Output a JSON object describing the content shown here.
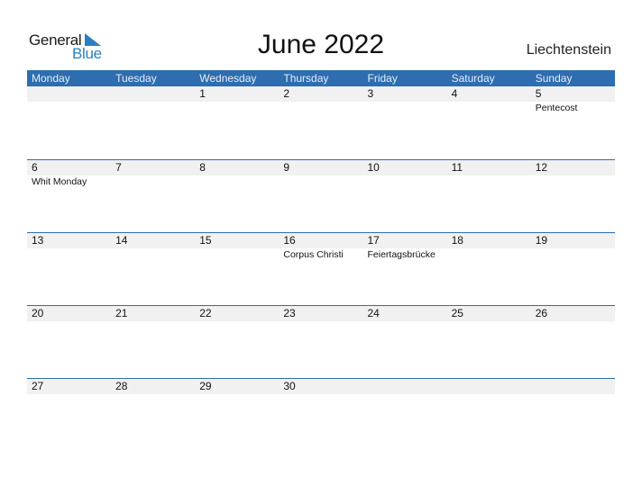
{
  "logo": {
    "general": "General",
    "blue": "Blue"
  },
  "title": "June 2022",
  "country": "Liechtenstein",
  "weekdays": [
    "Monday",
    "Tuesday",
    "Wednesday",
    "Thursday",
    "Friday",
    "Saturday",
    "Sunday"
  ],
  "weeks": [
    {
      "dates": [
        "",
        "",
        "1",
        "2",
        "3",
        "4",
        "5"
      ],
      "holidays": [
        "",
        "",
        "",
        "",
        "",
        "",
        "Pentecost"
      ]
    },
    {
      "dates": [
        "6",
        "7",
        "8",
        "9",
        "10",
        "11",
        "12"
      ],
      "holidays": [
        "Whit Monday",
        "",
        "",
        "",
        "",
        "",
        ""
      ]
    },
    {
      "dates": [
        "13",
        "14",
        "15",
        "16",
        "17",
        "18",
        "19"
      ],
      "holidays": [
        "",
        "",
        "",
        "Corpus Christi",
        "Feiertagsbrücke",
        "",
        ""
      ]
    },
    {
      "dates": [
        "20",
        "21",
        "22",
        "23",
        "24",
        "25",
        "26"
      ],
      "holidays": [
        "",
        "",
        "",
        "",
        "",
        "",
        ""
      ]
    },
    {
      "dates": [
        "27",
        "28",
        "29",
        "30",
        "",
        "",
        ""
      ],
      "holidays": [
        "",
        "",
        "",
        "",
        "",
        "",
        ""
      ]
    }
  ],
  "colors": {
    "header": "#2e6daf",
    "date_strip": "#f1f1f1",
    "logo_blue": "#2a7fc1"
  }
}
